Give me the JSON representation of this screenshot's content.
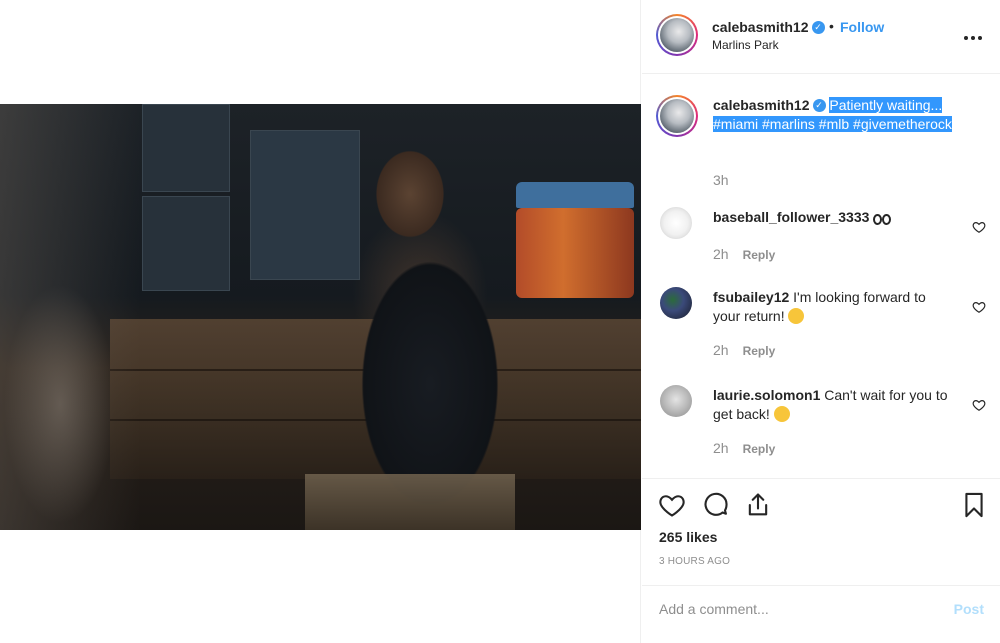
{
  "post": {
    "username": "calebasmith12",
    "verified_icon": "verified-badge-icon",
    "separator": "•",
    "follow_label": "Follow",
    "location": "Marlins Park",
    "options_icon": "more-options-icon"
  },
  "caption": {
    "username": "calebasmith12",
    "text": "Patiently waiting... #miami #marlins #mlb #givemetherock",
    "time": "3h"
  },
  "comments": [
    {
      "username": "baseball_follower_3333",
      "text": "",
      "emoji": "eyes-emoji",
      "time": "2h",
      "reply": "Reply"
    },
    {
      "username": "fsubailey12",
      "text": "I'm looking forward to your return!",
      "emoji": "hugging-emoji",
      "time": "2h",
      "reply": "Reply"
    },
    {
      "username": "laurie.solomon1",
      "text": "Can't wait for you to get back!",
      "emoji": "kissing-emoji",
      "time": "2h",
      "reply": "Reply"
    }
  ],
  "engagement": {
    "likes": "265 likes",
    "posted": "3 HOURS AGO"
  },
  "composer": {
    "placeholder": "Add a comment...",
    "post_label": "Post"
  },
  "colors": {
    "accent": "#3897f0",
    "selection": "#3297fd",
    "muted": "#8e8e8e",
    "post_disabled": "#b2dffc"
  }
}
